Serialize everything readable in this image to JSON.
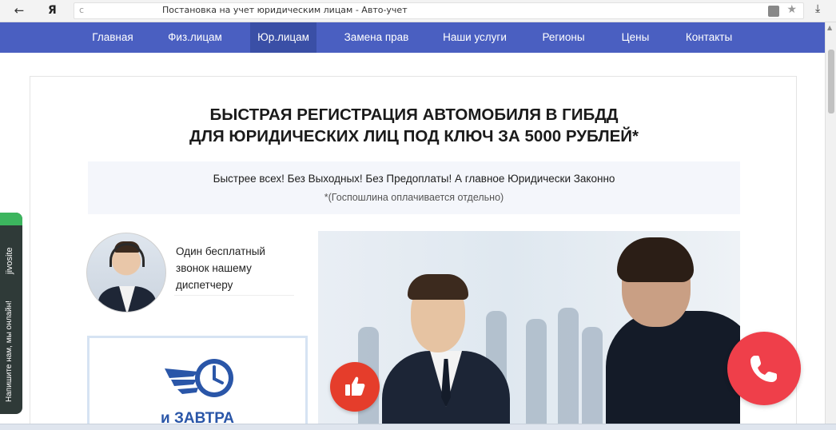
{
  "browser": {
    "back": "←",
    "logo": "Я",
    "reload": "c",
    "tab_title": "Постановка на учет юридическим лицам - Авто-учет",
    "star": "★",
    "download": "⤓"
  },
  "nav": {
    "items": [
      {
        "label": "Главная"
      },
      {
        "label": "Физ.лицам"
      },
      {
        "label": "Юр.лицам"
      },
      {
        "label": "Замена прав"
      },
      {
        "label": "Наши услуги"
      },
      {
        "label": "Регионы"
      },
      {
        "label": "Цены"
      },
      {
        "label": "Контакты"
      }
    ],
    "active_index": 2
  },
  "hero": {
    "headline_line1": "БЫСТРАЯ РЕГИСТРАЦИЯ АВТОМОБИЛЯ В ГИБДД",
    "headline_line2": "ДЛЯ ЮРИДИЧЕСКИХ ЛИЦ ПОД КЛЮЧ ЗА 5000 РУБЛЕЙ*",
    "promo_main": "Быстрее всех! Без Выходных! Без Предоплаты! А главное Юридически Законно",
    "promo_note": "*(Госпошлина оплачивается отдельно)"
  },
  "call_block": {
    "line1": "Один бесплатный",
    "line2": "звонок нашему",
    "line3": "диспетчеру"
  },
  "tomorrow_card": {
    "text": "и ЗАВТРА"
  },
  "jivo": {
    "brand": "jivosite",
    "message": "Напишите нам, мы онлайн!"
  },
  "colors": {
    "nav_bg": "#4a5fc1",
    "accent_blue": "#2a56a8",
    "like_red": "#e53d2b",
    "call_red": "#ef3f4a",
    "jivo_green": "#3cb55e"
  }
}
